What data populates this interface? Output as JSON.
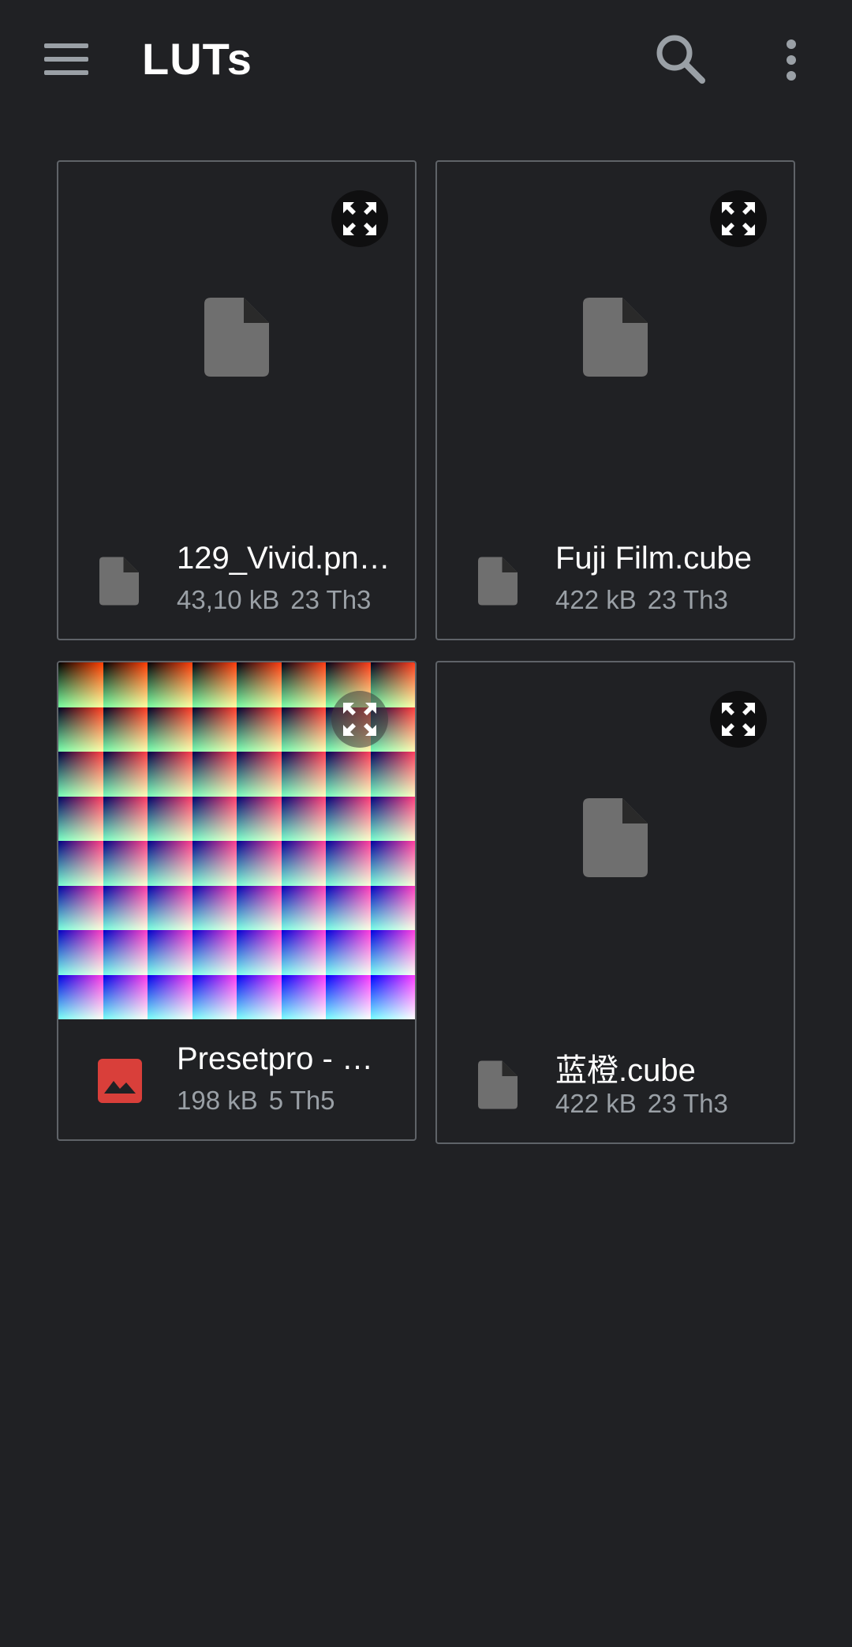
{
  "header": {
    "title": "LUTs",
    "menu_icon": "menu-icon",
    "search_icon": "search-icon",
    "more_icon": "more-vert-icon"
  },
  "files": [
    {
      "name": "129_Vivid.pn…",
      "size": "43,10 kB",
      "date": "23 Th3",
      "type_icon": "file-icon"
    },
    {
      "name": "Fuji Film.cube",
      "size": "422 kB",
      "date": "23 Th3",
      "type_icon": "file-icon"
    },
    {
      "name": "Presetpro  - …",
      "size": "198 kB",
      "date": "5 Th5",
      "type_icon": "image-icon"
    },
    {
      "name": "蓝橙.cube",
      "size": "422 kB",
      "date": "23 Th3",
      "type_icon": "file-icon"
    }
  ],
  "colors": {
    "background": "#202124",
    "card_border": "#5f6368",
    "file_icon": "#6f6f6f",
    "image_icon": "#d93f3a",
    "secondary_text": "#9aa0a6"
  }
}
